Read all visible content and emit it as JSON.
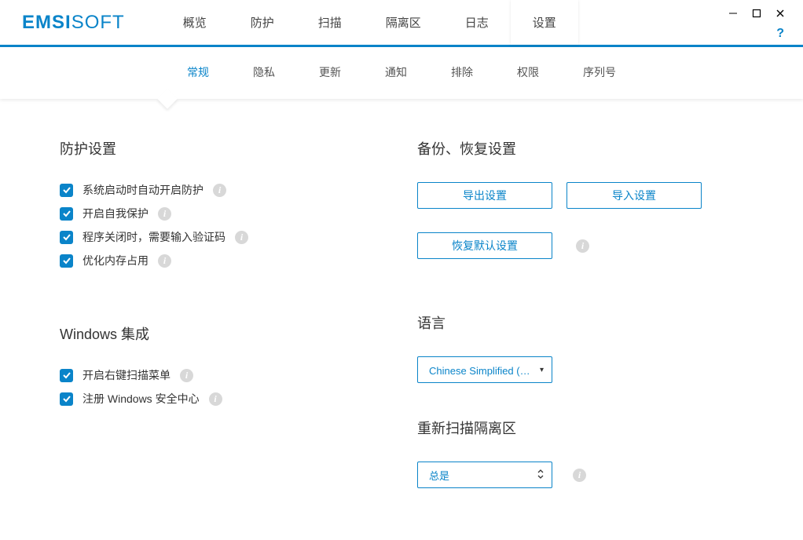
{
  "logo": {
    "bold": "EMSI",
    "light": "SOFT"
  },
  "topnav": [
    {
      "label": "概览"
    },
    {
      "label": "防护"
    },
    {
      "label": "扫描"
    },
    {
      "label": "隔离区"
    },
    {
      "label": "日志"
    },
    {
      "label": "设置",
      "active": true
    }
  ],
  "subnav": [
    {
      "label": "常规",
      "active": true
    },
    {
      "label": "隐私"
    },
    {
      "label": "更新"
    },
    {
      "label": "通知"
    },
    {
      "label": "排除"
    },
    {
      "label": "权限"
    },
    {
      "label": "序列号"
    }
  ],
  "sections": {
    "protection": {
      "title": "防护设置",
      "opts": [
        {
          "label": "系统启动时自动开启防护"
        },
        {
          "label": "开启自我保护"
        },
        {
          "label": "程序关闭时，需要输入验证码"
        },
        {
          "label": "优化内存占用"
        }
      ]
    },
    "windows": {
      "title": "Windows 集成",
      "opts": [
        {
          "label": "开启右键扫描菜单"
        },
        {
          "label": "注册 Windows 安全中心"
        }
      ]
    },
    "backup": {
      "title": "备份、恢复设置",
      "export": "导出设置",
      "import": "导入设置",
      "restore": "恢复默认设置"
    },
    "language": {
      "title": "语言",
      "value": "Chinese Simplified (简体中文)"
    },
    "rescan": {
      "title": "重新扫描隔离区",
      "value": "总是"
    }
  }
}
